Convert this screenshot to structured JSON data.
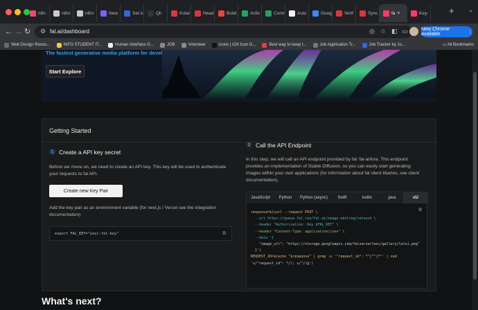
{
  "tabs": [
    {
      "title": "n8n",
      "color": "#ea4b71"
    },
    {
      "title": "n8n/",
      "color": "#c9c9c9"
    },
    {
      "title": "n8n/",
      "color": "#c9c9c9"
    },
    {
      "title": "New",
      "color": "#7b61ff"
    },
    {
      "title": "Set A",
      "color": "#2e6bd8"
    },
    {
      "title": "Qli",
      "color": "#333333"
    },
    {
      "title": "Kotai",
      "color": "#d9363e"
    },
    {
      "title": "Head",
      "color": "#d9363e"
    },
    {
      "title": "Build",
      "color": "#e8463c"
    },
    {
      "title": "Activ",
      "color": "#25a55f"
    },
    {
      "title": "Comm",
      "color": "#2f9a5b"
    },
    {
      "title": "Auto",
      "color": "#f1f1f1"
    },
    {
      "title": "Goog",
      "color": "#4285f4"
    },
    {
      "title": "Verif",
      "color": "#d9363e"
    },
    {
      "title": "Sync",
      "color": "#d9363e"
    },
    {
      "title": "fa",
      "color": "#ff3b6b",
      "active": true
    },
    {
      "title": "Key-",
      "color": "#ff3b6b"
    }
  ],
  "browser": {
    "url": "fal.ai/dashboard",
    "update_label": "New Chrome available",
    "new_tab_glyph": "+",
    "menu_glyph": "⌄"
  },
  "bookmarks": [
    {
      "label": "Web Design Resou...",
      "color": "#6a6a6a"
    },
    {
      "label": "INFO STUDENT IT...",
      "color": "#f2c94c"
    },
    {
      "label": "Human Interface G...",
      "color": "#eeeeee"
    },
    {
      "label": "JOB",
      "color": "#8a8a8a"
    },
    {
      "label": "Volunteer",
      "color": "#8a8a8a"
    },
    {
      "label": "Icons | iOS Icon G...",
      "color": "#111111"
    },
    {
      "label": "Best way to keep t...",
      "color": "#d44"
    },
    {
      "label": "Job Application Tr...",
      "color": "#777777"
    },
    {
      "label": "Job Tracker by Jo...",
      "color": "#2e6bd8"
    }
  ],
  "all_bookmarks_label": "All Bookmarks",
  "hero": {
    "tagline": "The fastest generative media platform for developers.",
    "start_label": "Start Explore"
  },
  "getting_started": {
    "title": "Getting Started",
    "step1": {
      "num": "1",
      "title": "Create a API key secret",
      "desc_lines": [
        "Before we move on, we need to create an API key. This key will be used to authenticate",
        "your requests to fal API."
      ],
      "button": "Create new Key Pair",
      "env_desc_lines": [
        "Add the key pair as an environment variable (for next.js / Vercel see the integration",
        "documentation)"
      ],
      "env_code": "export FAL_KEY=\"your-fal-key\""
    },
    "step2": {
      "num": "2",
      "title": "Call the API Endpoint",
      "desc_lines": [
        "In this step, we will call an API endpoint provided by fal: fal-ai/lora. This endpoint",
        "provides an implementation of Stable Diffusion, so you can easily start generating",
        "images within your own applications (for information about fal client libaries, see client",
        "documentation)."
      ],
      "lang_tabs": [
        "JavaScript",
        "Python",
        "Python (async)",
        "Swift",
        "kotlin",
        "java",
        "cU"
      ],
      "active_lang": 6,
      "code_lines": [
        "response=$(curl --request POST \\",
        "  --url https://queue.fal.run/fal-ai/image-editing/retouch \\",
        "  --header \"Authorization: Key $FAL_KEY\" \\",
        "  --header \"Content-Type: application/json\" \\",
        "  --data '{",
        "    \"image_url\": \"https://storage.googleapis.com/falserverless/gallery/tulsi.png\"",
        "  }')",
        "REQUEST_ID=$(echo \"$response\" | grep -o '\"request_id\": *\"[^\"]*\"' | sed",
        "'s/\"request_id\": *//; s/\"//g')"
      ]
    }
  },
  "whats_next": "What's next?"
}
